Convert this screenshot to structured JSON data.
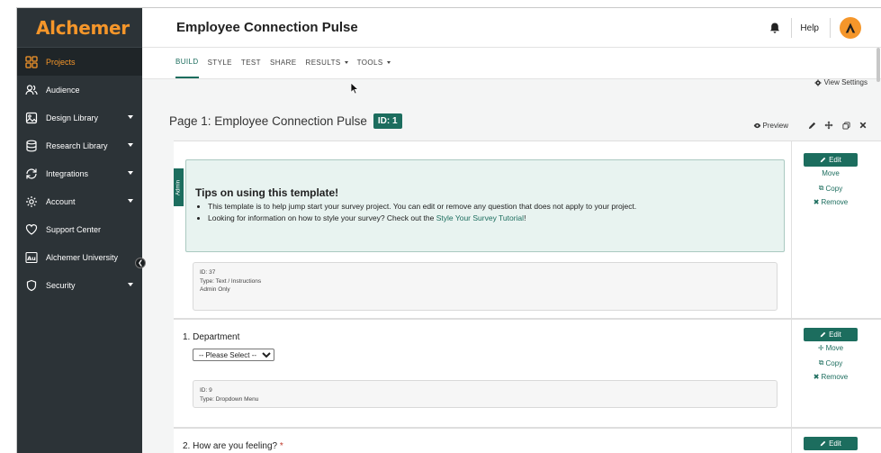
{
  "app": {
    "brand": "Alchemer",
    "survey_title": "Employee Connection Pulse",
    "help_label": "Help"
  },
  "sidebar": {
    "items": [
      {
        "label": "Projects",
        "icon": "grid-icon",
        "active": true,
        "has_caret": false
      },
      {
        "label": "Audience",
        "icon": "people-icon",
        "active": false,
        "has_caret": false
      },
      {
        "label": "Design Library",
        "icon": "image-icon",
        "active": false,
        "has_caret": true
      },
      {
        "label": "Research Library",
        "icon": "database-icon",
        "active": false,
        "has_caret": true
      },
      {
        "label": "Integrations",
        "icon": "sync-icon",
        "active": false,
        "has_caret": true
      },
      {
        "label": "Account",
        "icon": "gear-icon",
        "active": false,
        "has_caret": true
      },
      {
        "label": "Support Center",
        "icon": "heart-icon",
        "active": false,
        "has_caret": false
      },
      {
        "label": "Alchemer University",
        "icon": "au-badge-icon",
        "active": false,
        "has_caret": false
      },
      {
        "label": "Security",
        "icon": "shield-icon",
        "active": false,
        "has_caret": true
      }
    ]
  },
  "tabs": [
    {
      "label": "BUILD",
      "active": true,
      "caret": false
    },
    {
      "label": "STYLE",
      "active": false,
      "caret": false
    },
    {
      "label": "TEST",
      "active": false,
      "caret": false
    },
    {
      "label": "SHARE",
      "active": false,
      "caret": false
    },
    {
      "label": "RESULTS",
      "active": false,
      "caret": true
    },
    {
      "label": "TOOLS",
      "active": false,
      "caret": true
    }
  ],
  "view_settings_label": "View Settings",
  "page": {
    "title": "Page 1: Employee Connection Pulse",
    "id_badge": "ID: 1",
    "preview_label": "Preview"
  },
  "tips_card": {
    "admin_tab": "Admin",
    "title": "Tips on using this template!",
    "bullet1": "This template is to help jump start your survey project. You can edit or remove any question that does not apply to your project.",
    "bullet2_prefix": "Looking for information on how to style your survey? Check out the ",
    "bullet2_link": "Style Your Survey Tutorial",
    "bullet2_suffix": "!",
    "meta_id": "ID: 37",
    "meta_type": "Type: Text / Instructions",
    "meta_admin": "Admin Only",
    "actions": {
      "edit": "Edit",
      "move": "Move",
      "copy": "Copy",
      "remove": "Remove"
    }
  },
  "question1": {
    "title": "1. Department",
    "select_value": "-- Please Select --",
    "meta_id": "ID: 9",
    "meta_type": "Type: Dropdown Menu",
    "actions": {
      "edit": "Edit",
      "move": "Move",
      "copy": "Copy",
      "remove": "Remove"
    }
  },
  "question2": {
    "title": "2. How are you feeling?",
    "required_mark": "*",
    "actions": {
      "edit": "Edit"
    }
  },
  "colors": {
    "accent": "#1c6d5e",
    "brand_orange": "#f5962a",
    "sidebar_bg": "#2c3337"
  }
}
